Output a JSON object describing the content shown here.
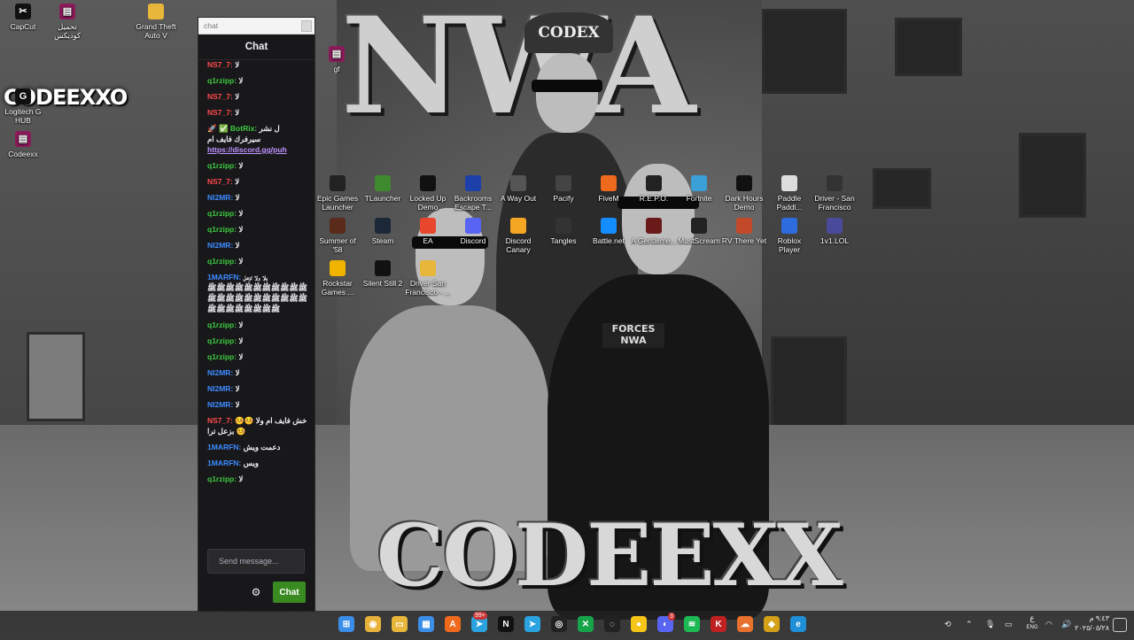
{
  "wallpaper": {
    "title": "NWA",
    "subtitle": "CODEEXX",
    "logo": "CODEEXXO",
    "cap_text": "CODEX",
    "badge_text": "FORCES NWA"
  },
  "desktop_icons_left": [
    {
      "label": "CapCut",
      "icon": "capcut-icon",
      "color": "#111111"
    },
    {
      "label": "تحميل كوديكس",
      "icon": "winrar-icon",
      "color": "#8b1a5a"
    },
    {
      "label": "Grand Theft Auto V",
      "icon": "folder-icon",
      "color": "#e8b63a"
    },
    {
      "label": "Logitech G HUB",
      "icon": "logitech-icon",
      "color": "#111111"
    },
    {
      "label": "Codeexx",
      "icon": "winrar-icon",
      "color": "#8b1a5a"
    },
    {
      "label": "gf",
      "icon": "winrar-icon",
      "color": "#8b1a5a"
    }
  ],
  "desktop_icons_grid": [
    {
      "label": "Epic Games Launcher",
      "icon": "epic-icon",
      "color": "#222222"
    },
    {
      "label": "TLauncher",
      "icon": "tlauncher-icon",
      "color": "#3f8a2e"
    },
    {
      "label": "Locked Up Demo",
      "icon": "game-icon",
      "color": "#111111"
    },
    {
      "label": "Backrooms Escape T...",
      "icon": "game-icon",
      "color": "#1c3faa"
    },
    {
      "label": "A Way Out",
      "icon": "game-icon",
      "color": "#555555"
    },
    {
      "label": "Pacify",
      "icon": "game-icon",
      "color": "#444444"
    },
    {
      "label": "FiveM",
      "icon": "fivem-icon",
      "color": "#f06a1d"
    },
    {
      "label": "R.E.P.O.",
      "icon": "game-icon",
      "color": "#222222"
    },
    {
      "label": "Fortnite",
      "icon": "fortnite-icon",
      "color": "#3b9fd8"
    },
    {
      "label": "Dark Hours Demo",
      "icon": "game-icon",
      "color": "#111111"
    },
    {
      "label": "Paddle Paddl...",
      "icon": "game-icon",
      "color": "#dddddd"
    },
    {
      "label": "Driver - San Francisco",
      "icon": "game-icon",
      "color": "#333333"
    },
    {
      "label": "Summer of '58",
      "icon": "game-icon",
      "color": "#5a2a1a"
    },
    {
      "label": "Steam",
      "icon": "steam-icon",
      "color": "#1b2838"
    },
    {
      "label": "EA",
      "icon": "ea-icon",
      "color": "#e8472d"
    },
    {
      "label": "Discord",
      "icon": "discord-icon",
      "color": "#5865f2"
    },
    {
      "label": "Discord Canary",
      "icon": "discord-canary-icon",
      "color": "#f5a623"
    },
    {
      "label": "Tangles",
      "icon": "game-icon",
      "color": "#333333"
    },
    {
      "label": "Battle.net",
      "icon": "battlenet-icon",
      "color": "#148eff"
    },
    {
      "label": "A Gentleme...",
      "icon": "game-icon",
      "color": "#6b1a1a"
    },
    {
      "label": "MustScream",
      "icon": "game-icon",
      "color": "#222222"
    },
    {
      "label": "RV There Yet",
      "icon": "game-icon",
      "color": "#c24a2a"
    },
    {
      "label": "Roblox Player",
      "icon": "roblox-icon",
      "color": "#2d6cdf"
    },
    {
      "label": "1v1.LOL",
      "icon": "game-icon",
      "color": "#4a4a9a"
    },
    {
      "label": "Rockstar Games ...",
      "icon": "rockstar-icon",
      "color": "#f0b400"
    },
    {
      "label": "Silent Still 2",
      "icon": "game-icon",
      "color": "#111111"
    },
    {
      "label": "Driver San Francisco - ...",
      "icon": "folder-icon",
      "color": "#e8b63a"
    }
  ],
  "chat": {
    "search_placeholder": "chat",
    "title": "Chat",
    "messages": [
      {
        "user": "NS7_7:",
        "color": "#ff4a4a",
        "text": "لا"
      },
      {
        "user": "q1rzipp:",
        "color": "#3ec93e",
        "text": "لا"
      },
      {
        "user": "NS7_7:",
        "color": "#ff4a4a",
        "text": "لا"
      },
      {
        "user": "NS7_7:",
        "color": "#ff4a4a",
        "text": "لا"
      },
      {
        "badges": "🚀 ✅",
        "user": "BotRix:",
        "color": "#3ec93e",
        "text": "ل نشر سيرفرك فايف ام ",
        "link": "https://discord.gg/puh"
      },
      {
        "user": "q1rzipp:",
        "color": "#3ec93e",
        "text": "لا"
      },
      {
        "user": "NS7_7:",
        "color": "#ff4a4a",
        "text": "لا"
      },
      {
        "user": "NI2MR:",
        "color": "#3d8bff",
        "text": "لا"
      },
      {
        "user": "q1rzipp:",
        "color": "#3ec93e",
        "text": "لا"
      },
      {
        "user": "q1rzipp:",
        "color": "#3ec93e",
        "text": "لا"
      },
      {
        "user": "NI2MR:",
        "color": "#3d8bff",
        "text": "لا"
      },
      {
        "user": "q1rzipp:",
        "color": "#3ec93e",
        "text": "لا"
      },
      {
        "user": "1MARFN:",
        "color": "#3d8bff",
        "text": "يلا ولا تزعل ﷺﷺﷺﷺﷺﷺﷺﷺﷺﷺﷺﷺﷺﷺﷺﷺﷺﷺﷺﷺﷺﷺﷺﷺﷺﷺﷺﷺﷺﷺ"
      },
      {
        "user": "q1rzipp:",
        "color": "#3ec93e",
        "text": "لا"
      },
      {
        "user": "q1rzipp:",
        "color": "#3ec93e",
        "text": "لا"
      },
      {
        "user": "q1rzipp:",
        "color": "#3ec93e",
        "text": "لا"
      },
      {
        "user": "NI2MR:",
        "color": "#3d8bff",
        "text": "لا"
      },
      {
        "user": "NI2MR:",
        "color": "#3d8bff",
        "text": "لا"
      },
      {
        "user": "NI2MR:",
        "color": "#3d8bff",
        "text": "لا"
      },
      {
        "user": "NS7_7:",
        "color": "#ff4a4a",
        "text": "خش فايف ام ولا 🤒🤒🤒 بزعل ترا"
      },
      {
        "user": "1MARFN:",
        "color": "#3d8bff",
        "text": "دعمت ويش"
      },
      {
        "user": "1MARFN:",
        "color": "#3d8bff",
        "text": "ويس"
      },
      {
        "user": "q1rzipp:",
        "color": "#3ec93e",
        "text": "لا"
      }
    ],
    "input_placeholder": "Send message...",
    "send_label": "Chat"
  },
  "taskbar": {
    "apps": [
      {
        "name": "start-icon",
        "color": "#3b8ee8",
        "glyph": "⊞"
      },
      {
        "name": "chrome-icon",
        "color": "#e8b23a",
        "glyph": "◉"
      },
      {
        "name": "file-explorer-icon",
        "color": "#e8b63a",
        "glyph": "▭"
      },
      {
        "name": "ms-store-icon",
        "color": "#3b8ee8",
        "glyph": "▦"
      },
      {
        "name": "fivem-icon",
        "color": "#f06a1d",
        "glyph": "A"
      },
      {
        "name": "telegram-icon",
        "color": "#2aa3e0",
        "glyph": "➤"
      },
      {
        "name": "netflix-icon",
        "color": "#111111",
        "glyph": "N"
      },
      {
        "name": "telegram-icon-2",
        "color": "#2aa3e0",
        "glyph": "➤"
      },
      {
        "name": "obs-icon",
        "color": "#222222",
        "glyph": "◎"
      },
      {
        "name": "xbox-icon",
        "color": "#17a34a",
        "glyph": "✕"
      },
      {
        "name": "capture-icon",
        "color": "#222222",
        "glyph": "◌"
      },
      {
        "name": "app-icon-yellow",
        "color": "#f5c518",
        "glyph": "●"
      },
      {
        "name": "discord-icon",
        "color": "#5865f2",
        "glyph": "◐"
      },
      {
        "name": "spotify-icon",
        "color": "#1db954",
        "glyph": "≋"
      },
      {
        "name": "kick-icon",
        "color": "#c0201f",
        "glyph": "K"
      },
      {
        "name": "cloud-icon",
        "color": "#e8722d",
        "glyph": "☁"
      },
      {
        "name": "game-icon",
        "color": "#d4a017",
        "glyph": "◆"
      },
      {
        "name": "edge-icon",
        "color": "#1f8fd8",
        "glyph": "e"
      }
    ],
    "telegram_badge": "99+",
    "discord_badge": "3",
    "tray_lang": "ع",
    "tray_lang_sub": "ENG",
    "time": "٩:٤٣ م",
    "date": "٢٠٢٥/٠٥/٢٨"
  }
}
